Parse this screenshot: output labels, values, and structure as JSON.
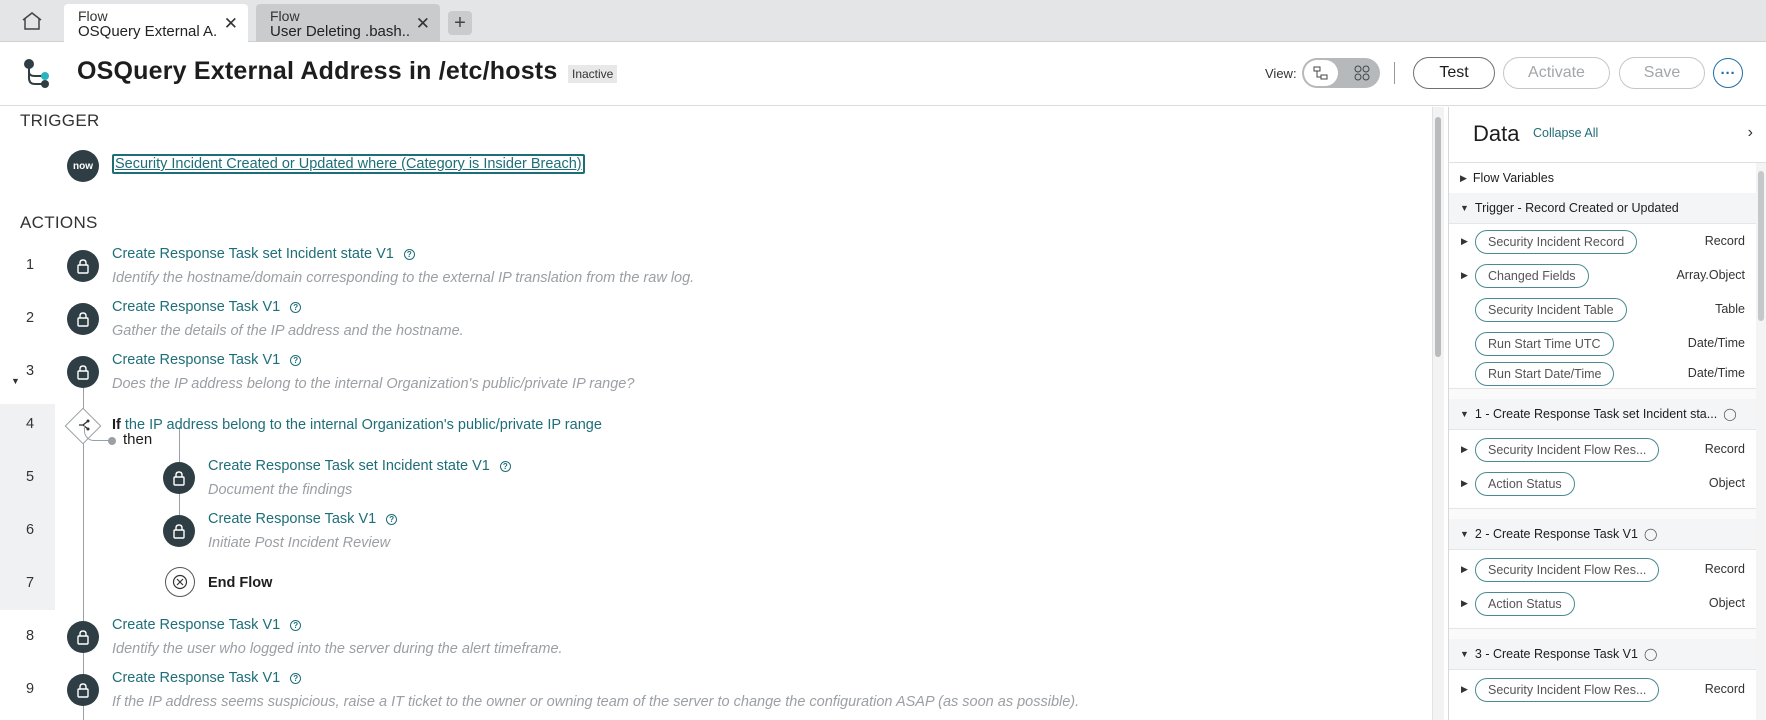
{
  "tabs": [
    {
      "label": "Flow",
      "title": "OSQuery External A..."
    },
    {
      "label": "Flow",
      "title": "User Deleting .bash..."
    }
  ],
  "header": {
    "title": "OSQuery External Address in /etc/hosts",
    "status": "Inactive",
    "view_label": "View:",
    "test_label": "Test",
    "activate_label": "Activate",
    "save_label": "Save"
  },
  "trigger": {
    "heading": "TRIGGER",
    "icon_text": "now",
    "condition": "Security Incident Created or Updated where (Category is Insider Breach)"
  },
  "actions_heading": "ACTIONS",
  "actions": [
    {
      "num": "1",
      "title": "Create Response Task set Incident state V1",
      "desc": "Identify the hostname/domain corresponding to the external IP translation from the raw log."
    },
    {
      "num": "2",
      "title": "Create Response Task V1",
      "desc": "Gather the details of the IP address and the hostname."
    },
    {
      "num": "3",
      "title": "Create Response Task V1",
      "desc": "Does the IP address belong to the internal Organization's public/private IP range?"
    },
    {
      "num": "5",
      "title": "Create Response Task set Incident state V1",
      "desc": "Document the findings"
    },
    {
      "num": "6",
      "title": "Create Response Task V1",
      "desc": "Initiate Post Incident Review"
    },
    {
      "num": "8",
      "title": "Create Response Task V1",
      "desc": "Identify the user who logged into the server during the alert timeframe."
    },
    {
      "num": "9",
      "title": "Create Response Task V1",
      "desc": "If the IP address seems suspicious, raise a IT ticket to the owner or owning team of the server to change the configuration ASAP (as soon as possible)."
    }
  ],
  "if_step": {
    "num": "4",
    "keyword": "If",
    "condition": "the IP address belong to the internal Organization's public/private IP range"
  },
  "then_label": "then",
  "end_flow": {
    "num": "7",
    "label": "End Flow"
  },
  "data_panel": {
    "title": "Data",
    "collapse_all": "Collapse All",
    "flow_variables": "Flow Variables",
    "trigger_group": "Trigger - Record Created or Updated",
    "trigger_pills": [
      {
        "name": "Security Incident Record",
        "type": "Record"
      },
      {
        "name": "Changed Fields",
        "type": "Array.Object"
      },
      {
        "name": "Security Incident Table",
        "type": "Table"
      },
      {
        "name": "Run Start Time UTC",
        "type": "Date/Time"
      },
      {
        "name": "Run Start Date/Time",
        "type": "Date/Time"
      }
    ],
    "group1": "1 - Create Response Task set Incident sta...",
    "group1_pills": [
      {
        "name": "Security Incident Flow Res...",
        "type": "Record"
      },
      {
        "name": "Action Status",
        "type": "Object"
      }
    ],
    "group2": "2 - Create Response Task V1",
    "group2_pills": [
      {
        "name": "Security Incident Flow Res...",
        "type": "Record"
      },
      {
        "name": "Action Status",
        "type": "Object"
      }
    ],
    "group3": "3 - Create Response Task V1",
    "group3_pills": [
      {
        "name": "Security Incident Flow Res...",
        "type": "Record"
      }
    ]
  }
}
